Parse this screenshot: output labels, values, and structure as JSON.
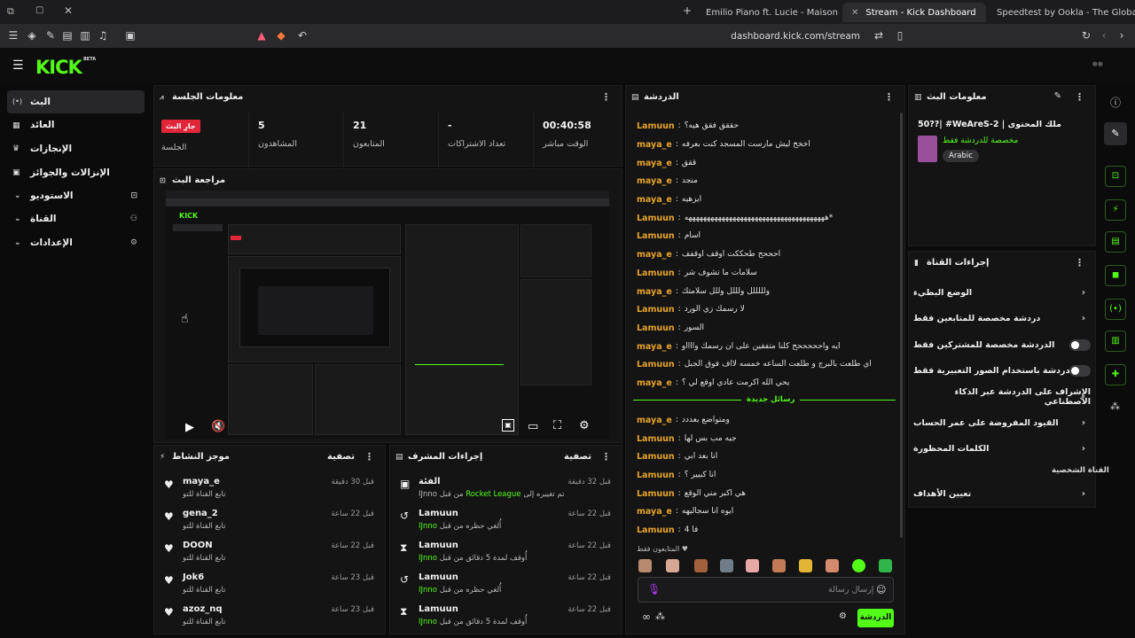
{
  "browser": {
    "tabs": [
      {
        "title": "Emilio Piano ft. Lucie - Maison - YouT",
        "icon_color": "#ff0000"
      },
      {
        "title": "Stream - Kick Dashboard",
        "icon_color": "#53fc18"
      },
      {
        "title": "Speedtest by Ookla - The Global Broa",
        "icon_color": "#1b1b1b"
      }
    ],
    "url": "dashboard.kick.com/stream"
  },
  "brand": {
    "logo": "KICK",
    "badge": "BETA",
    "accent": "#53fc18"
  },
  "nav": {
    "items": [
      {
        "label": "البث",
        "icon": "(•)"
      },
      {
        "label": "العائد",
        "icon": "▦"
      },
      {
        "label": "الإنجازات",
        "icon": "🏆"
      },
      {
        "label": "الإنزالات والجوائز",
        "icon": "▣"
      },
      {
        "label": "الاستوديو",
        "icon": "⌄"
      },
      {
        "label": "القناة",
        "icon": "⌄"
      },
      {
        "label": "الإعدادات",
        "icon": "⌄"
      }
    ]
  },
  "session": {
    "title": "معلومات الجلسة",
    "live_badge": "جارِ البث",
    "live_label": "الجلسة",
    "stats": [
      {
        "value": "5",
        "label": "المشاهدون"
      },
      {
        "value": "21",
        "label": "المتابعون"
      },
      {
        "value": "-",
        "label": "تعداد الاشتراكات"
      },
      {
        "value": "00:40:58",
        "label": "الوقت مباشر"
      }
    ]
  },
  "preview": {
    "title": "مراجعة البث"
  },
  "activity": {
    "title": "موجز النشاط",
    "filter": "تصفية",
    "rows": [
      {
        "name": "maya_e",
        "sub": "تابع القناة للتو",
        "time": "قبل 30 دقيقة"
      },
      {
        "name": "gena_2",
        "sub": "تابع القناة للتو",
        "time": "قبل 22 ساعة"
      },
      {
        "name": "DOON",
        "sub": "تابع القناة للتو",
        "time": "قبل 22 ساعة"
      },
      {
        "name": "Jok6",
        "sub": "تابع القناة للتو",
        "time": "قبل 23 ساعة"
      },
      {
        "name": "azoz_nq",
        "sub": "تابع القناة للتو",
        "time": "قبل 23 ساعة"
      }
    ]
  },
  "modactions": {
    "title": "إجراءات المشرف",
    "filter": "تصفية",
    "rows": [
      {
        "name": "الفئة",
        "sub_pre": "تم تغييره إلى ",
        "sub_hl": "Rocket League",
        "sub_post": " من قبل IJnno",
        "time": "قبل 32 دقيقة",
        "icon": "▣"
      },
      {
        "name": "Lamuun",
        "sub_pre": "أُلغي حظره من قبل ",
        "sub_hl": "IJnno",
        "sub_post": "",
        "time": "قبل 22 ساعة",
        "icon": "↺"
      },
      {
        "name": "Lamuun",
        "sub_pre": "أُوقف لمدة 5 دقائق من قبل ",
        "sub_hl": "IJnno",
        "sub_post": "",
        "time": "قبل 22 ساعة",
        "icon": "⧗"
      },
      {
        "name": "Lamuun",
        "sub_pre": "أُلغي حظره من قبل ",
        "sub_hl": "IJnno",
        "sub_post": "",
        "time": "قبل 22 ساعة",
        "icon": "↺"
      },
      {
        "name": "Lamuun",
        "sub_pre": "أُوقف لمدة 5 دقائق من قبل ",
        "sub_hl": "IJnno",
        "sub_post": "",
        "time": "قبل 22 ساعة",
        "icon": "⧗"
      }
    ]
  },
  "chat": {
    "title": "الدردشة",
    "new_messages": "رسائل جديدة",
    "followers_only": "المتابعون فقط",
    "input_placeholder": "إرسال رسالة",
    "send": "الدردشة",
    "messages": [
      {
        "user": "Lamuun",
        "color": "#e8a52b",
        "text": "حققق فقق هيه؟"
      },
      {
        "user": "maya_e",
        "color": "#e8a52b",
        "text": "اخخخ ليش مارست المسجد كنت بعرفه"
      },
      {
        "user": "maya_e",
        "color": "#e8a52b",
        "text": "ققق"
      },
      {
        "user": "maya_e",
        "color": "#e8a52b",
        "text": "منجد"
      },
      {
        "user": "maya_e",
        "color": "#e8a52b",
        "text": "ايزهيه"
      },
      {
        "user": "Lamuun",
        "color": "#e8a52b",
        "text": "*ههههههههههههههههههههههههههههههههههههههه"
      },
      {
        "user": "Lamuun",
        "color": "#e8a52b",
        "text": "اسام"
      },
      {
        "user": "maya_e",
        "color": "#e8a52b",
        "text": "احححح طحككت اوقف اوقفف"
      },
      {
        "user": "Lamuun",
        "color": "#e8a52b",
        "text": "سلامات ما تشوف شر"
      },
      {
        "user": "maya_e",
        "color": "#e8a52b",
        "text": "ولللللل ولللل وللل سلامتك"
      },
      {
        "user": "Lamuun",
        "color": "#e8a52b",
        "text": "لا رسمك زي الورد"
      },
      {
        "user": "Lamuun",
        "color": "#e8a52b",
        "text": "السور"
      },
      {
        "user": "maya_e",
        "color": "#e8a52b",
        "text": "ايه واحححححح كلنا متفقين على ان رسمك وااااو"
      },
      {
        "user": "Lamuun",
        "color": "#e8a52b",
        "text": "اي طلعت بالبرج و طلعت الساعه خمسه لااف فوق الجبل"
      },
      {
        "user": "maya_e",
        "color": "#e8a52b",
        "text": "يحي الله اكرمت عادي اوقع لي ؟"
      },
      {
        "user": "maya_e",
        "color": "#e8a52b",
        "text": "ومتواضع بعددد"
      },
      {
        "user": "Lamuun",
        "color": "#e8a52b",
        "text": "جيه مب بس لها"
      },
      {
        "user": "Lamuun",
        "color": "#e8a52b",
        "text": "انا بعد ابي"
      },
      {
        "user": "Lamuun",
        "color": "#e8a52b",
        "text": "انا كبيير ؟"
      },
      {
        "user": "Lamuun",
        "color": "#e8a52b",
        "text": "هي اكبر مني الوقع"
      },
      {
        "user": "maya_e",
        "color": "#e8a52b",
        "text": "ايوه انا سجاليهه"
      },
      {
        "user": "Lamuun",
        "color": "#e8a52b",
        "text": "فا 4"
      }
    ]
  },
  "stream_info": {
    "title": "معلومات البث",
    "stream_title": "50??| #WeAreS-2 | ملك المحتوى",
    "category": "مخصصة للدردشة فقط",
    "language": "Arabic"
  },
  "channel_actions": {
    "title": "إجراءات القناة",
    "rows": [
      {
        "label": "الوضع البطيء",
        "type": "chevron"
      },
      {
        "label": "دردشة مخصصة للمتابعين فقط",
        "type": "chevron"
      },
      {
        "label": "الدردشة مخصصة للمشتركين فقط",
        "type": "toggle"
      },
      {
        "label": "الدردشة باستخدام الصور التعبيرية فقط",
        "type": "toggle"
      },
      {
        "label": "الإشراف على الدردشة عبر الذكاء الاصطناعي",
        "type": "external"
      },
      {
        "label": "القيود المفروضة على عمر الحساب",
        "type": "chevron"
      },
      {
        "label": "الكلمات المحظورة",
        "type": "chevron"
      }
    ],
    "section": "القناة الشخصية",
    "target": "تعيين الأهداف"
  }
}
